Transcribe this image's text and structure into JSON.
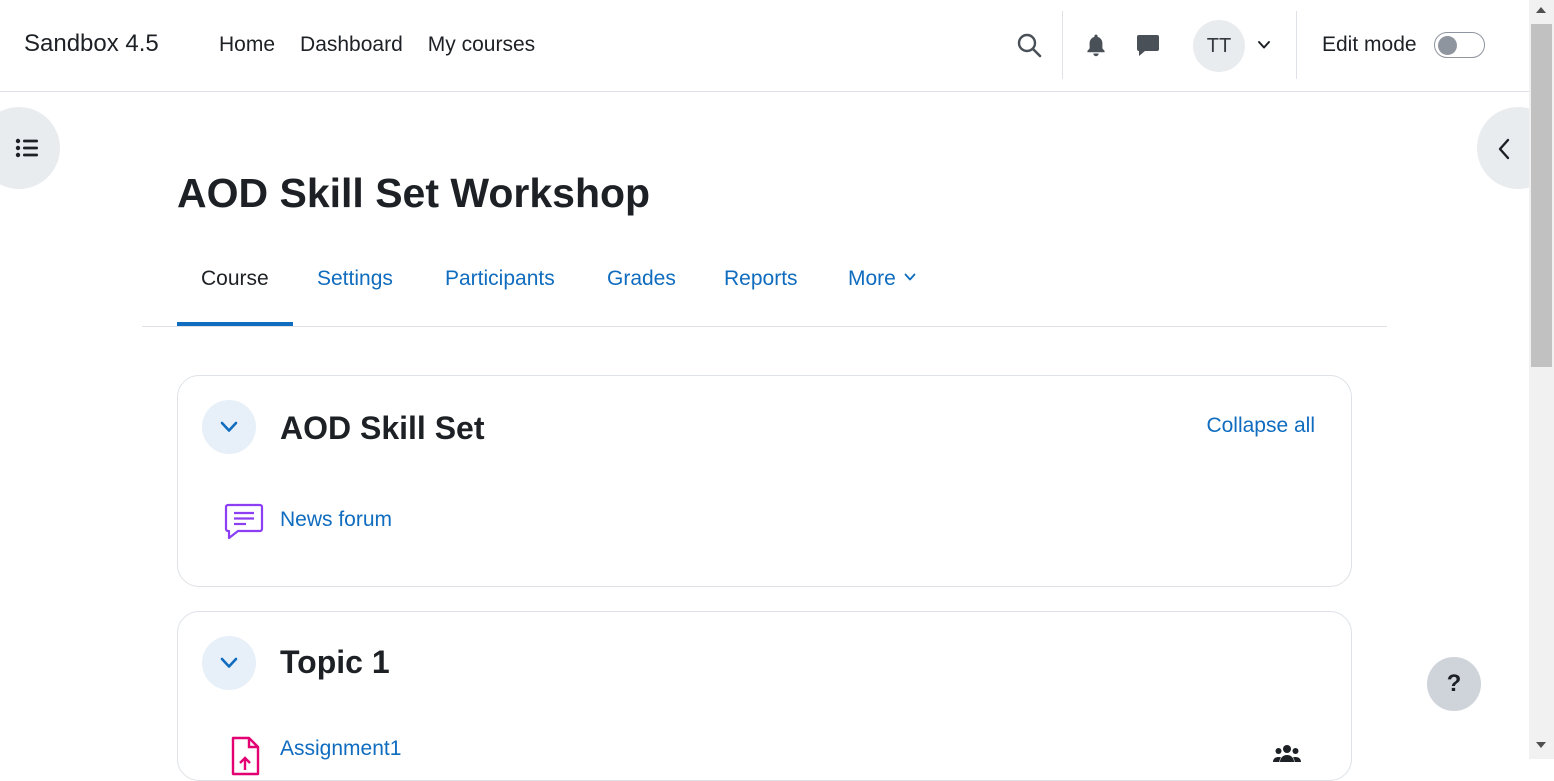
{
  "navbar": {
    "brand": "Sandbox 4.5",
    "links": [
      "Home",
      "Dashboard",
      "My courses"
    ],
    "avatar_initials": "TT",
    "edit_mode_label": "Edit mode",
    "edit_mode_on": false
  },
  "course": {
    "title": "AOD Skill Set Workshop",
    "tabs": [
      {
        "label": "Course",
        "active": true
      },
      {
        "label": "Settings"
      },
      {
        "label": "Participants"
      },
      {
        "label": "Grades"
      },
      {
        "label": "Reports"
      },
      {
        "label": "More"
      }
    ]
  },
  "sections": [
    {
      "title": "AOD Skill Set",
      "action": "Collapse all",
      "activities": [
        {
          "name": "News forum",
          "icon": "forum-icon"
        }
      ]
    },
    {
      "title": "Topic 1",
      "activities": [
        {
          "name": "Assignment1",
          "icon": "assignment-icon"
        }
      ]
    }
  ],
  "help": {
    "label": "?"
  },
  "colors": {
    "link": "#0f6cbf",
    "text": "#1d2125",
    "forum_icon": "#8b3ef2",
    "assignment_icon": "#e30072"
  }
}
